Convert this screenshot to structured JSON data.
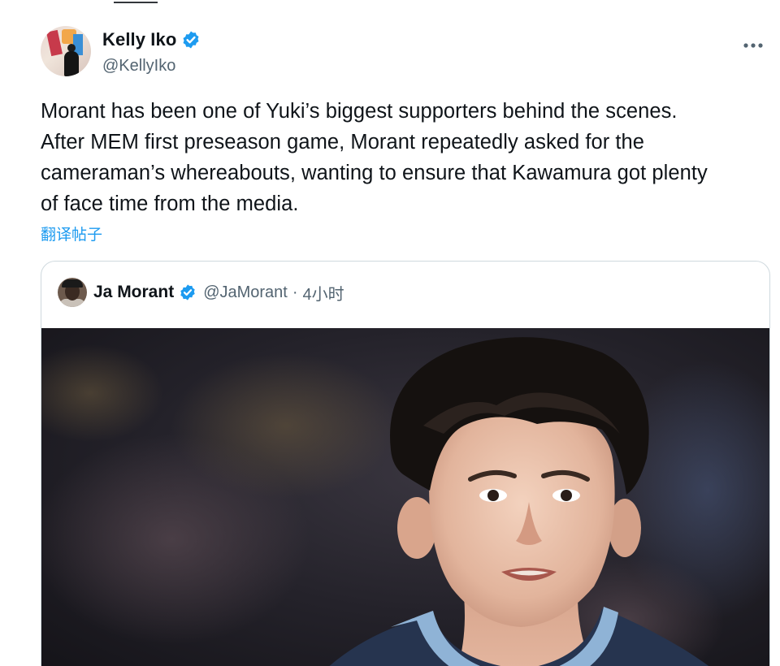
{
  "post": {
    "author": {
      "display_name": "Kelly Iko",
      "handle": "@KellyIko",
      "verified": true
    },
    "more_icon": "more-horizontal-icon",
    "text_lines": [
      "Morant has been one of Yuki’s biggest supporters behind the scenes.",
      "After MEM first preseason game, Morant repeatedly asked for the",
      "cameraman’s whereabouts, wanting to ensure that Kawamura got plenty",
      "of face time from the media."
    ],
    "translate_label": "翻译帖子"
  },
  "quoted_post": {
    "author": {
      "display_name": "Ja Morant",
      "handle": "@JaMorant",
      "verified": true
    },
    "separator": "·",
    "time": "4小时"
  },
  "colors": {
    "text_primary": "#0f1419",
    "text_secondary": "#536471",
    "accent": "#1d9bf0",
    "border": "#cfd9de",
    "jersey": "#26344f",
    "jersey_trim": "#8fb3d6"
  }
}
